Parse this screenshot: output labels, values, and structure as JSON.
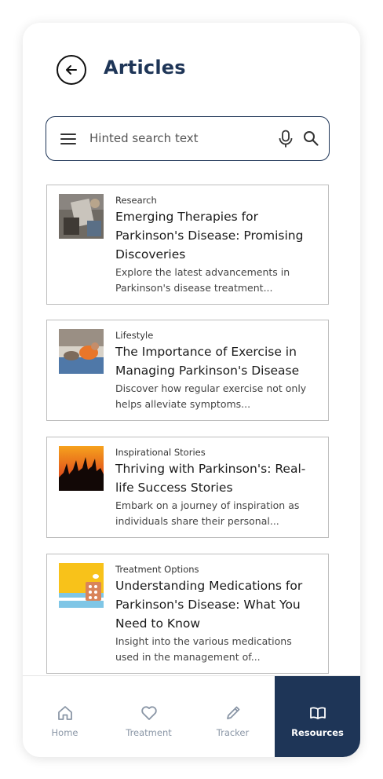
{
  "header": {
    "title": "Articles",
    "back_icon": "arrow-left-circle-icon"
  },
  "search": {
    "placeholder": "Hinted search text",
    "menu_icon": "menu-icon",
    "mic_icon": "mic-icon",
    "search_icon": "search-icon"
  },
  "articles": [
    {
      "category": "Research",
      "title": "Emerging Therapies for Parkinson's Disease: Promising Discoveries",
      "description": "Explore the latest advancements in Parkinson's disease treatment..."
    },
    {
      "category": "Lifestyle",
      "title": "The Importance of Exercise in Managing Parkinson's Disease",
      "description": "Discover how regular exercise not only helps alleviate symptoms..."
    },
    {
      "category": "Inspirational Stories",
      "title": "Thriving with Parkinson's: Real-life Success Stories",
      "description": "Embark on a journey of inspiration as individuals share their personal..."
    },
    {
      "category": "Treatment Options",
      "title": "Understanding Medications for Parkinson's Disease: What You Need to Know",
      "description": "Insight into the various medications used in the management of..."
    }
  ],
  "nav": {
    "items": [
      {
        "label": "Home",
        "icon": "home-icon"
      },
      {
        "label": "Treatment",
        "icon": "heart-icon"
      },
      {
        "label": "Tracker",
        "icon": "pencil-icon"
      },
      {
        "label": "Resources",
        "icon": "book-icon",
        "active": true
      }
    ]
  },
  "colors": {
    "primary": "#1e3557",
    "nav_inactive": "#8a96a6",
    "card_border": "#bdbdbd"
  }
}
